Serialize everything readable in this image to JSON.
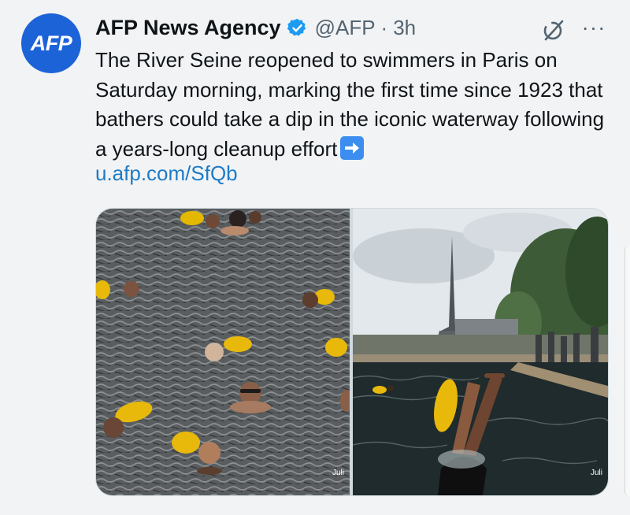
{
  "account": {
    "avatar_text": "AFP",
    "avatar_color": "#1d63d8",
    "name": "AFP News Agency",
    "verified_color": "#1d9bf0",
    "handle": "@AFP",
    "separator": "·",
    "time": "3h"
  },
  "actions": {
    "grok_icon": "grok-icon",
    "more_label": "···"
  },
  "tweet": {
    "text": "The River Seine reopened to swimmers in Paris on Saturday morning, marking the first time since 1923 that bathers could take a dip in the iconic waterway following a years-long cleanup effort",
    "emoji_icon": "right-arrow-emoji",
    "link": "u.afp.com/SfQb",
    "link_color": "#1d7bc7"
  },
  "media": {
    "photos": [
      {
        "credit": "Juli"
      },
      {
        "credit": "Juli"
      }
    ]
  }
}
